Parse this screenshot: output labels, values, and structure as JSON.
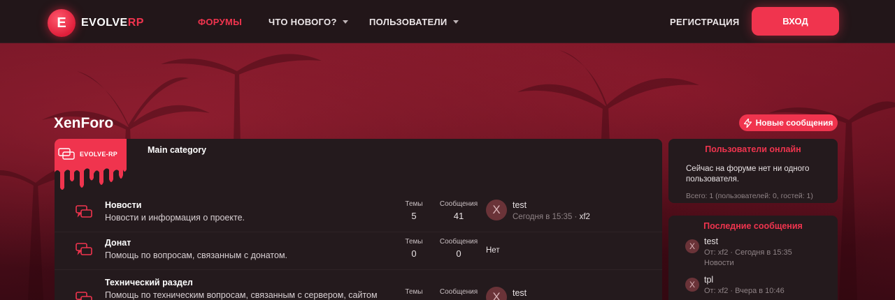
{
  "header": {
    "logo_text_part1": "EVOLVE",
    "logo_text_part2": "RP",
    "logo_letter": "E",
    "nav": {
      "forums": "ФОРУМЫ",
      "whats_new": "ЧТО НОВОГО?",
      "members": "ПОЛЬЗОВАТЕЛИ",
      "register": "РЕГИСТРАЦИЯ",
      "login": "ВХОД"
    }
  },
  "page": {
    "title": "XenForo",
    "new_posts_button": "Новые сообщения"
  },
  "category": {
    "badge_label": "EVOLVE-RP",
    "title": "Main category"
  },
  "labels": {
    "topics": "Темы",
    "posts": "Сообщения",
    "none": "Нет"
  },
  "forums": [
    {
      "name": "Новости",
      "description": "Новости и информация о проекте.",
      "topics": "5",
      "posts": "41",
      "last_title": "test",
      "last_date": "Сегодня в 15:35",
      "last_sep": " · ",
      "last_user": "xf2",
      "avatar_letter": "X"
    },
    {
      "name": "Донат",
      "description": "Помощь по вопросам, связанным с донатом.",
      "topics": "0",
      "posts": "0"
    },
    {
      "name": "Технический раздел",
      "description": "Помощь по техническим вопросам, связанным с сервером, сайтом",
      "last_title": "test",
      "avatar_letter": "X"
    }
  ],
  "sidebar": {
    "online": {
      "title": "Пользователи онлайн",
      "text": "Сейчас на форуме нет ни одного пользователя.",
      "footer": "Всего: 1 (пользователей: 0, гостей: 1)"
    },
    "latest": {
      "title": "Последние сообщения",
      "items": [
        {
          "avatar_letter": "X",
          "title": "test",
          "meta": "От: xf2 · Сегодня в 15:35",
          "forum": "Новости"
        },
        {
          "avatar_letter": "X",
          "title": "tpl",
          "meta": "От: xf2 · Вчера в 10:46"
        }
      ]
    }
  },
  "colors": {
    "accent": "#f0344e",
    "topbar": "#221619",
    "panel": "#241a1d"
  }
}
